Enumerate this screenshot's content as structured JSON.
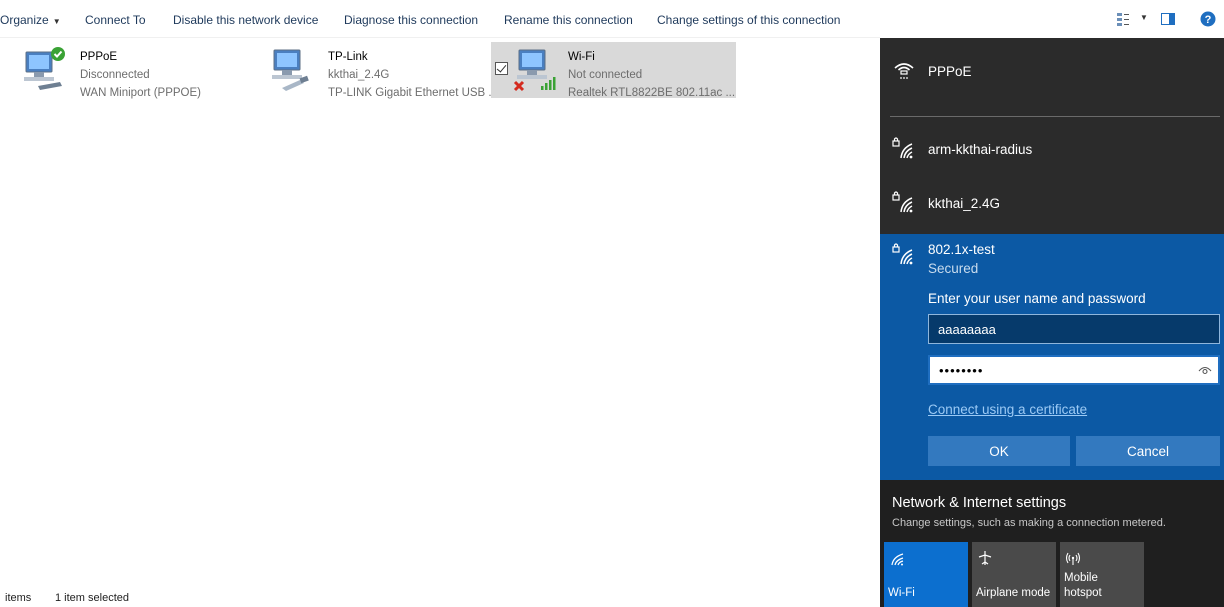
{
  "toolbar": {
    "organize": "Organize",
    "connect_to": "Connect To",
    "disable": "Disable this network device",
    "diagnose": "Diagnose this connection",
    "rename": "Rename this connection",
    "change_settings": "Change settings of this connection"
  },
  "connections": [
    {
      "name": "PPPoE",
      "status": "Disconnected",
      "device": "WAN Miniport (PPPOE)"
    },
    {
      "name": "TP-Link",
      "status": "kkthai_2.4G",
      "device": "TP-LINK Gigabit Ethernet USB ..."
    },
    {
      "name": "Wi-Fi",
      "status": "Not connected",
      "device": "Realtek RTL8822BE 802.11ac ..."
    }
  ],
  "statusbar": {
    "items": "items",
    "selected": "1 item selected"
  },
  "flyout": {
    "networks": [
      {
        "name": "PPPoE"
      },
      {
        "name": "arm-kkthai-radius"
      },
      {
        "name": "kkthai_2.4G"
      }
    ],
    "expanded": {
      "name": "802.1x-test",
      "security": "Secured",
      "prompt": "Enter your user name and password",
      "username_value": "aaaaaaaa",
      "password_value": "••••••••",
      "cert_link": "Connect using a certificate",
      "ok": "OK",
      "cancel": "Cancel"
    },
    "settings": {
      "title": "Network & Internet settings",
      "subtitle": "Change settings, such as making a connection metered."
    },
    "tiles": {
      "wifi": "Wi-Fi",
      "airplane": "Airplane mode",
      "hotspot_line1": "Mobile",
      "hotspot_line2": "hotspot"
    }
  },
  "colors": {
    "accent": "#0c59a4",
    "flyout_bg": "#2b2b2b",
    "selected_row": "#d9d9d9",
    "wifi_tile": "#0c6fcf"
  }
}
